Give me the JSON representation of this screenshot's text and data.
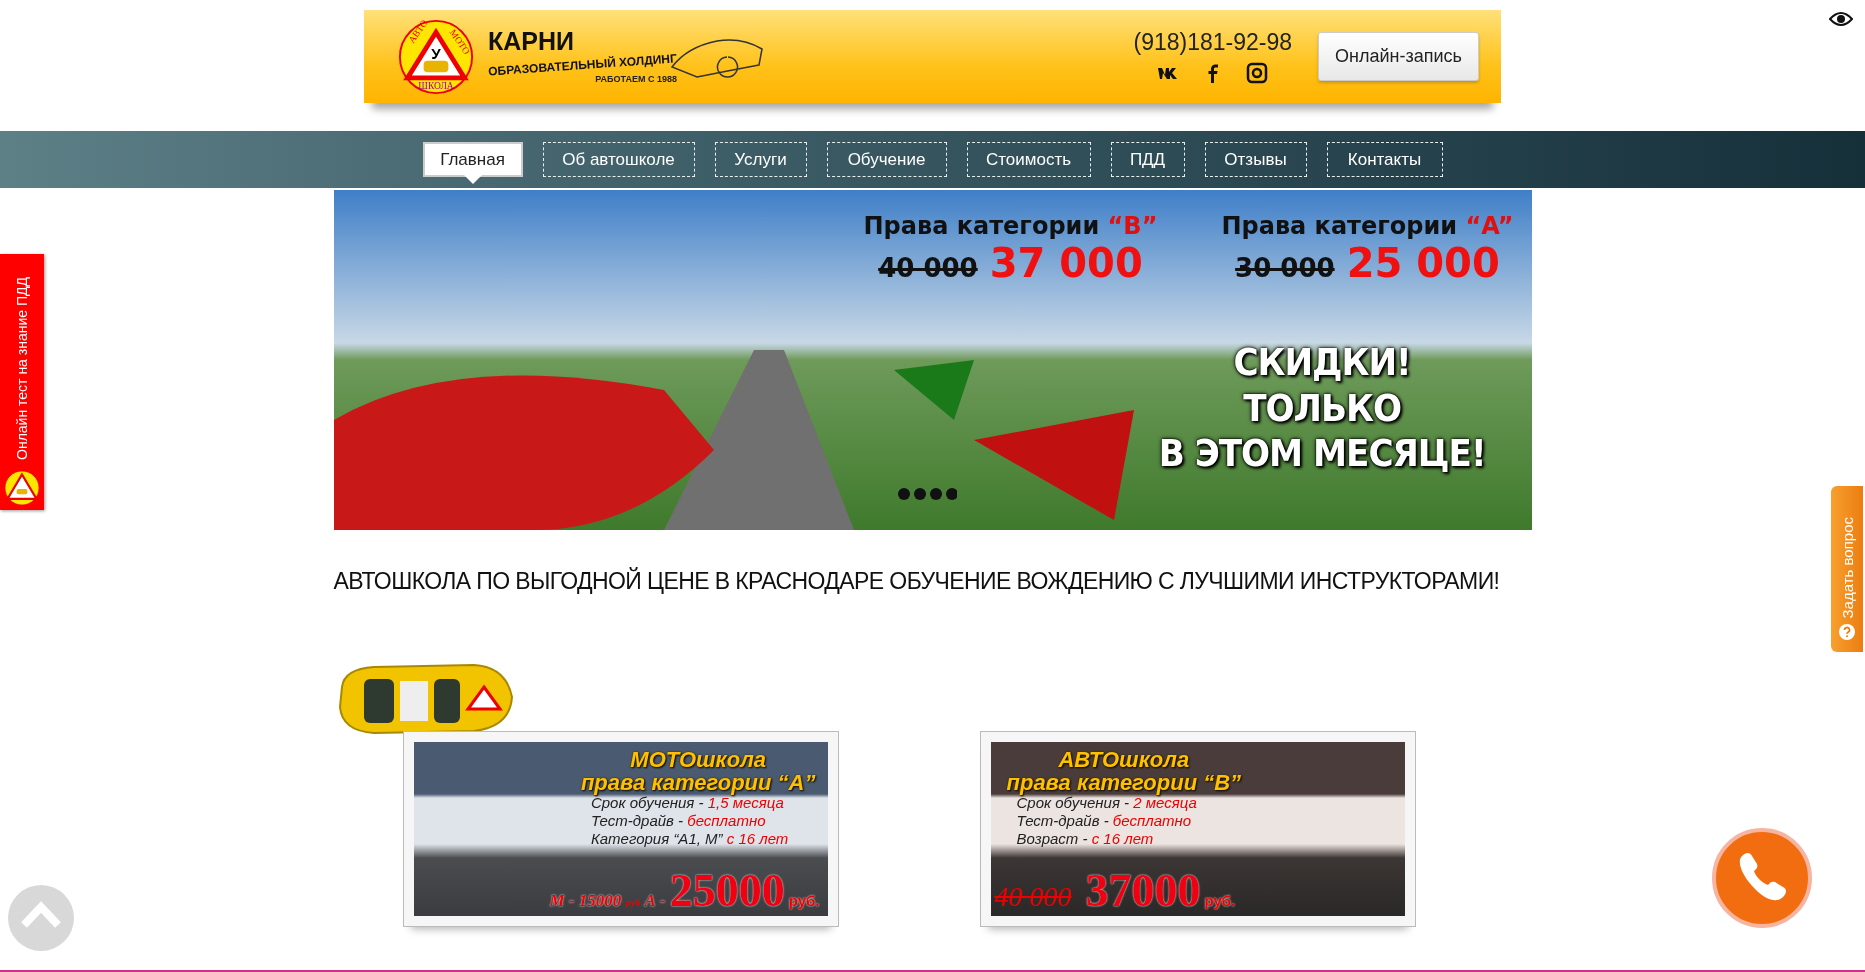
{
  "header": {
    "logo": {
      "top_left": "АВТО",
      "top_right": "МОТО",
      "bottom": "ШКОЛА",
      "sign": "У"
    },
    "brand": "КАРНИ",
    "subtitle": "ОБРАЗОВАТЕЛЬНЫЙ ХОЛДИНГ",
    "since": "РАБОТАЕМ С 1988",
    "phone": "(918)181-92-98",
    "cta": "Онлайн-запись"
  },
  "nav": [
    {
      "label": "Главная",
      "selected": true
    },
    {
      "label": "Об автошколе",
      "selected": false
    },
    {
      "label": "Услуги",
      "selected": false
    },
    {
      "label": "Обучение",
      "selected": false
    },
    {
      "label": "Стоимость",
      "selected": false
    },
    {
      "label": "ПДД",
      "selected": false
    },
    {
      "label": "Отзывы",
      "selected": false
    },
    {
      "label": "Контакты",
      "selected": false
    }
  ],
  "banner": {
    "offers": [
      {
        "title": "Права категории",
        "category": "“B”",
        "old_price": "40 000",
        "price": "37 000"
      },
      {
        "title": "Права категории",
        "category": "“A”",
        "old_price": "30 000",
        "price": "25 000"
      }
    ],
    "promo": [
      "СКИДКИ!",
      "ТОЛЬКО",
      "В ЭТОМ МЕСЯЦЕ!"
    ]
  },
  "heading": "АВТОШКОЛА ПО ВЫГОДНОЙ ЦЕНЕ В КРАСНОДАРЕ ОБУЧЕНИЕ ВОЖДЕНИЮ С ЛУЧШИМИ ИНСТРУКТОРАМИ!",
  "cards": [
    {
      "kind": "moto",
      "title": "МОТОшкола",
      "subtitle": "права категории “A”",
      "lines": [
        {
          "label": "Срок обучения - ",
          "value": "1,5 месяца"
        },
        {
          "label": "Тест-драйв - ",
          "value": "бесплатно"
        },
        {
          "label": "Категория “А1, М” ",
          "value": "с 16 лет"
        }
      ],
      "prefix": "М - 15000",
      "prefix_unit": "руб",
      "price_label": "А - ",
      "price": "25000",
      "unit": "руб."
    },
    {
      "kind": "auto",
      "title": "АВТОшкола",
      "subtitle": "права категории “B”",
      "lines": [
        {
          "label": "Срок обучения - ",
          "value": "2 месяца"
        },
        {
          "label": "Тест-драйв - ",
          "value": "бесплатно"
        },
        {
          "label": "Возраст - ",
          "value": "с 16 лет"
        }
      ],
      "old_price": "40 000",
      "price": "37000",
      "unit": "руб."
    }
  ],
  "side_tabs": {
    "left": "Онлайн тест на знание ПДД",
    "right": "Задать вопрос"
  }
}
